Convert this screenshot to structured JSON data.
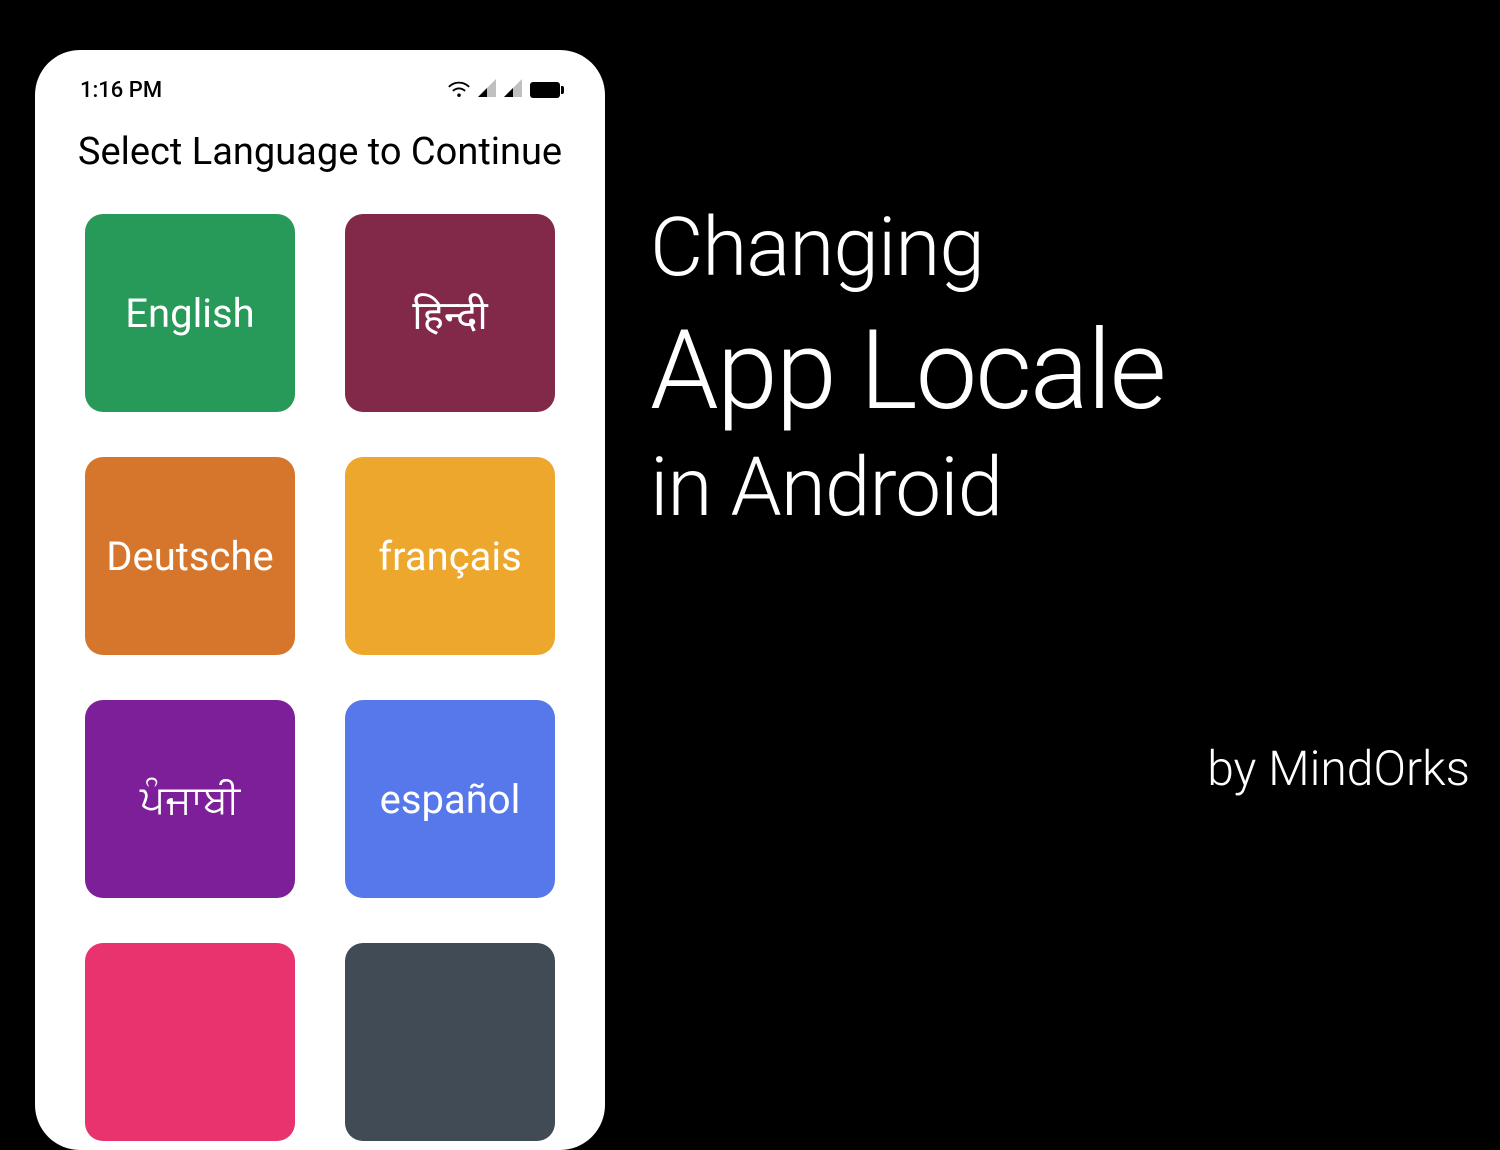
{
  "status_bar": {
    "time": "1:16 PM"
  },
  "page_title": "Select Language to Continue",
  "tiles": {
    "english": "English",
    "hindi": "हिन्दी",
    "deutsche": "Deutsche",
    "francais": "français",
    "punjabi": "ਪੰਜਾਬੀ",
    "espanol": "español"
  },
  "headline": {
    "line1": "Changing",
    "line2": "App Locale",
    "line3": "in Android"
  },
  "byline": "by MindOrks",
  "colors": {
    "english": "#279958",
    "hindi": "#822949",
    "deutsche": "#D6762C",
    "francais": "#EDA72C",
    "punjabi": "#7D1F98",
    "espanol": "#5778EA",
    "pink": "#E8336E",
    "dark": "#414B56"
  }
}
